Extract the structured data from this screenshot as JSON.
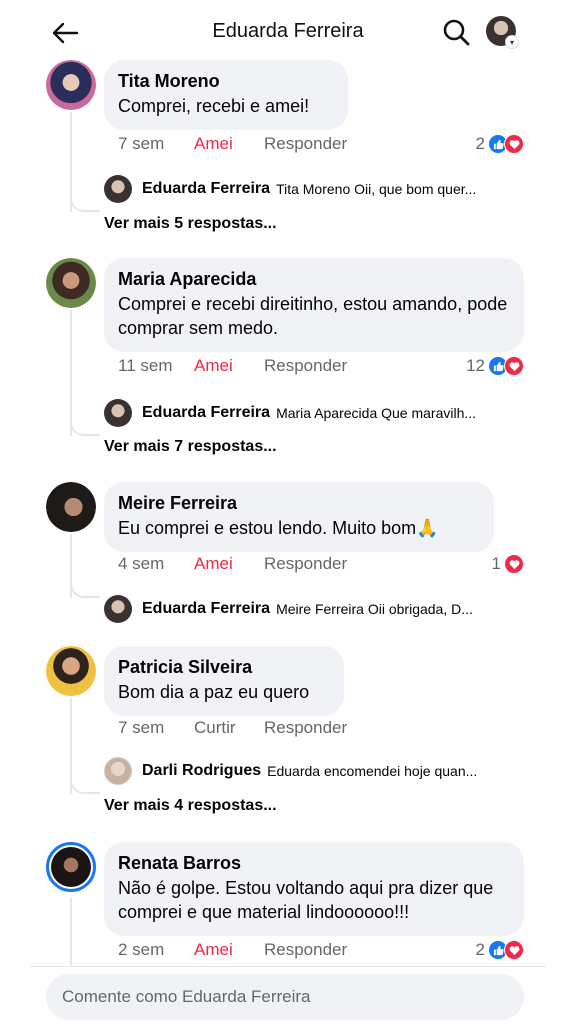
{
  "header": {
    "title": "Eduarda Ferreira",
    "back_icon": "arrow-left-icon",
    "search_icon": "search-icon"
  },
  "comments": [
    {
      "author": "Tita Moreno",
      "text": "Comprei, recebi e amei!",
      "time": "7 sem",
      "reaction": "Amei",
      "reply": "Responder",
      "count": "2",
      "reactions": [
        "like",
        "love"
      ],
      "sub_reply": {
        "name": "Eduarda Ferreira",
        "text": "Tita Moreno Oii, que bom quer..."
      },
      "more": "Ver mais 5 respostas..."
    },
    {
      "author": "Maria Aparecida",
      "text": "Comprei e recebi direitinho, estou amando, pode comprar sem medo.",
      "time": "11 sem",
      "reaction": "Amei",
      "reply": "Responder",
      "count": "12",
      "reactions": [
        "like",
        "love"
      ],
      "sub_reply": {
        "name": "Eduarda Ferreira",
        "text": "Maria Aparecida Que maravilh..."
      },
      "more": "Ver mais 7 respostas..."
    },
    {
      "author": "Meire Ferreira",
      "text": "Eu comprei e estou lendo. Muito bom🙏",
      "time": "4 sem",
      "reaction": "Amei",
      "reply": "Responder",
      "count": "1",
      "reactions": [
        "love"
      ],
      "sub_reply": {
        "name": "Eduarda Ferreira",
        "text": "Meire Ferreira  Oii obrigada, D..."
      },
      "more": ""
    },
    {
      "author": "Patricia Silveira",
      "text": "Bom dia a paz eu quero",
      "time": "7 sem",
      "reaction": "Curtir",
      "reply": "Responder",
      "count": "",
      "reactions": [],
      "sub_reply": {
        "name": "Darli Rodrigues",
        "text": "Eduarda encomendei hoje quan..."
      },
      "more": "Ver mais 4 respostas..."
    },
    {
      "author": "Renata Barros",
      "text": "Não é golpe. Estou voltando aqui pra dizer que comprei e que material lindoooooo!!!",
      "time": "2 sem",
      "reaction": "Amei",
      "reply": "Responder",
      "count": "2",
      "reactions": [
        "like",
        "love"
      ]
    }
  ],
  "composer": {
    "placeholder": "Comente como Eduarda Ferreira"
  },
  "colors": {
    "loved": "#f02849",
    "like": "#1877f2",
    "bubble": "#f0f2f5",
    "muted": "#65676b"
  }
}
